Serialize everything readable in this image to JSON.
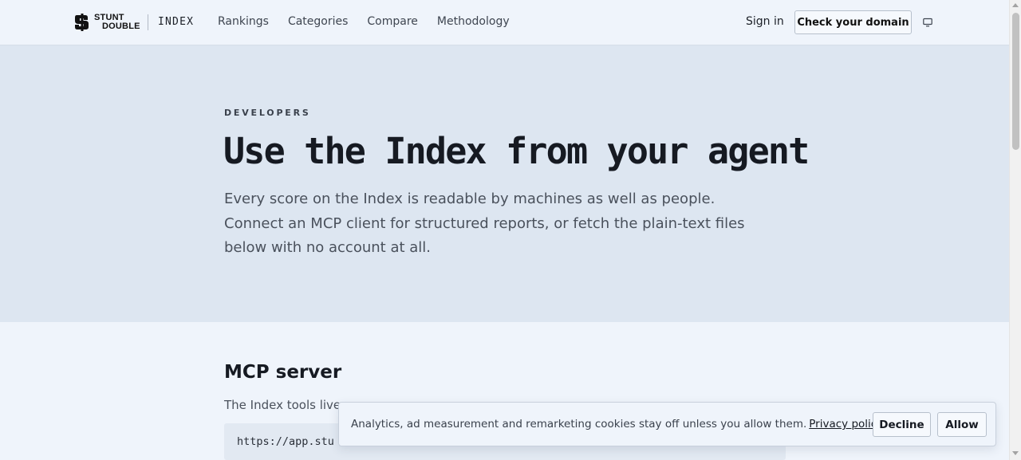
{
  "header": {
    "logo_line1": "STUNT",
    "logo_line2": "DOUBLE",
    "product": "INDEX",
    "nav": [
      "Rankings",
      "Categories",
      "Compare",
      "Methodology"
    ],
    "sign_in": "Sign in",
    "cta": "Check your domain",
    "theme_icon": "monitor-icon"
  },
  "hero": {
    "eyebrow": "DEVELOPERS",
    "title": "Use the Index from your agent",
    "subtitle": "Every score on the Index is readable by machines as well as people. Connect an MCP client for structured reports, or fetch the plain-text files below with no account at all."
  },
  "mcp": {
    "title": "MCP server",
    "text": "The Index tools live",
    "code": "https://app.stu"
  },
  "cookie": {
    "text": "Analytics, ad measurement and remarketing cookies stay off unless you allow them.",
    "link": "Privacy policy",
    "decline": "Decline",
    "allow": "Allow"
  },
  "colors": {
    "hero_bg": "#dde6f1",
    "page_bg": "#eff4fb"
  }
}
